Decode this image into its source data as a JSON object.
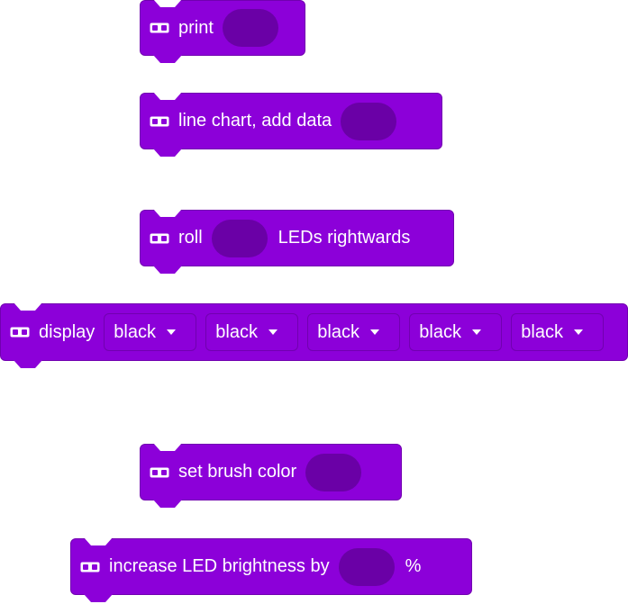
{
  "theme": {
    "block_color": "#8C00D9",
    "block_border": "#7100B0",
    "slot_color": "#6A00A6",
    "text_color": "#FFFFFF"
  },
  "blocks": {
    "print": {
      "label": "print",
      "icon": "led-matrix-icon"
    },
    "line_chart": {
      "label": "line chart, add data",
      "icon": "led-matrix-icon"
    },
    "roll": {
      "label_before": "roll",
      "label_after": "LEDs rightwards",
      "icon": "led-matrix-icon"
    },
    "display": {
      "label": "display",
      "icon": "led-matrix-icon",
      "options": [
        "black",
        "black",
        "black",
        "black",
        "black"
      ]
    },
    "brush": {
      "label": "set brush color",
      "icon": "led-matrix-icon"
    },
    "brightness": {
      "label_before": "increase LED brightness by",
      "label_after": "%",
      "icon": "led-matrix-icon"
    }
  }
}
